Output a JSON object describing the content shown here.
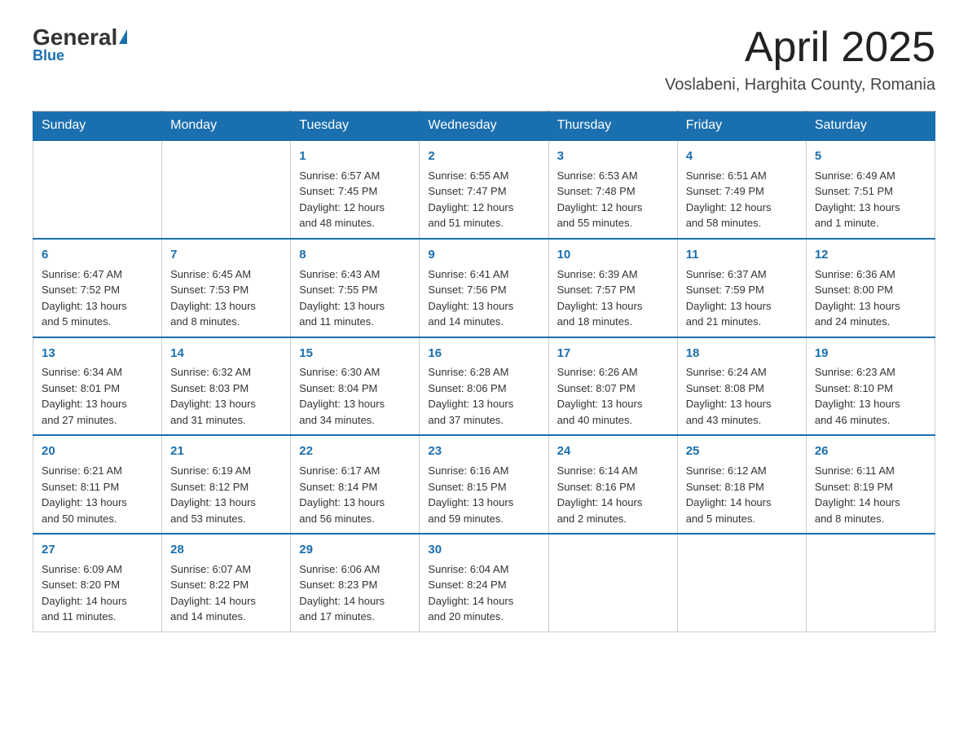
{
  "logo": {
    "general": "General",
    "blue": "Blue",
    "subtitle": "Blue"
  },
  "header": {
    "title": "April 2025",
    "location": "Voslabeni, Harghita County, Romania"
  },
  "days_of_week": [
    "Sunday",
    "Monday",
    "Tuesday",
    "Wednesday",
    "Thursday",
    "Friday",
    "Saturday"
  ],
  "weeks": [
    [
      {
        "day": "",
        "info": ""
      },
      {
        "day": "",
        "info": ""
      },
      {
        "day": "1",
        "info": "Sunrise: 6:57 AM\nSunset: 7:45 PM\nDaylight: 12 hours\nand 48 minutes."
      },
      {
        "day": "2",
        "info": "Sunrise: 6:55 AM\nSunset: 7:47 PM\nDaylight: 12 hours\nand 51 minutes."
      },
      {
        "day": "3",
        "info": "Sunrise: 6:53 AM\nSunset: 7:48 PM\nDaylight: 12 hours\nand 55 minutes."
      },
      {
        "day": "4",
        "info": "Sunrise: 6:51 AM\nSunset: 7:49 PM\nDaylight: 12 hours\nand 58 minutes."
      },
      {
        "day": "5",
        "info": "Sunrise: 6:49 AM\nSunset: 7:51 PM\nDaylight: 13 hours\nand 1 minute."
      }
    ],
    [
      {
        "day": "6",
        "info": "Sunrise: 6:47 AM\nSunset: 7:52 PM\nDaylight: 13 hours\nand 5 minutes."
      },
      {
        "day": "7",
        "info": "Sunrise: 6:45 AM\nSunset: 7:53 PM\nDaylight: 13 hours\nand 8 minutes."
      },
      {
        "day": "8",
        "info": "Sunrise: 6:43 AM\nSunset: 7:55 PM\nDaylight: 13 hours\nand 11 minutes."
      },
      {
        "day": "9",
        "info": "Sunrise: 6:41 AM\nSunset: 7:56 PM\nDaylight: 13 hours\nand 14 minutes."
      },
      {
        "day": "10",
        "info": "Sunrise: 6:39 AM\nSunset: 7:57 PM\nDaylight: 13 hours\nand 18 minutes."
      },
      {
        "day": "11",
        "info": "Sunrise: 6:37 AM\nSunset: 7:59 PM\nDaylight: 13 hours\nand 21 minutes."
      },
      {
        "day": "12",
        "info": "Sunrise: 6:36 AM\nSunset: 8:00 PM\nDaylight: 13 hours\nand 24 minutes."
      }
    ],
    [
      {
        "day": "13",
        "info": "Sunrise: 6:34 AM\nSunset: 8:01 PM\nDaylight: 13 hours\nand 27 minutes."
      },
      {
        "day": "14",
        "info": "Sunrise: 6:32 AM\nSunset: 8:03 PM\nDaylight: 13 hours\nand 31 minutes."
      },
      {
        "day": "15",
        "info": "Sunrise: 6:30 AM\nSunset: 8:04 PM\nDaylight: 13 hours\nand 34 minutes."
      },
      {
        "day": "16",
        "info": "Sunrise: 6:28 AM\nSunset: 8:06 PM\nDaylight: 13 hours\nand 37 minutes."
      },
      {
        "day": "17",
        "info": "Sunrise: 6:26 AM\nSunset: 8:07 PM\nDaylight: 13 hours\nand 40 minutes."
      },
      {
        "day": "18",
        "info": "Sunrise: 6:24 AM\nSunset: 8:08 PM\nDaylight: 13 hours\nand 43 minutes."
      },
      {
        "day": "19",
        "info": "Sunrise: 6:23 AM\nSunset: 8:10 PM\nDaylight: 13 hours\nand 46 minutes."
      }
    ],
    [
      {
        "day": "20",
        "info": "Sunrise: 6:21 AM\nSunset: 8:11 PM\nDaylight: 13 hours\nand 50 minutes."
      },
      {
        "day": "21",
        "info": "Sunrise: 6:19 AM\nSunset: 8:12 PM\nDaylight: 13 hours\nand 53 minutes."
      },
      {
        "day": "22",
        "info": "Sunrise: 6:17 AM\nSunset: 8:14 PM\nDaylight: 13 hours\nand 56 minutes."
      },
      {
        "day": "23",
        "info": "Sunrise: 6:16 AM\nSunset: 8:15 PM\nDaylight: 13 hours\nand 59 minutes."
      },
      {
        "day": "24",
        "info": "Sunrise: 6:14 AM\nSunset: 8:16 PM\nDaylight: 14 hours\nand 2 minutes."
      },
      {
        "day": "25",
        "info": "Sunrise: 6:12 AM\nSunset: 8:18 PM\nDaylight: 14 hours\nand 5 minutes."
      },
      {
        "day": "26",
        "info": "Sunrise: 6:11 AM\nSunset: 8:19 PM\nDaylight: 14 hours\nand 8 minutes."
      }
    ],
    [
      {
        "day": "27",
        "info": "Sunrise: 6:09 AM\nSunset: 8:20 PM\nDaylight: 14 hours\nand 11 minutes."
      },
      {
        "day": "28",
        "info": "Sunrise: 6:07 AM\nSunset: 8:22 PM\nDaylight: 14 hours\nand 14 minutes."
      },
      {
        "day": "29",
        "info": "Sunrise: 6:06 AM\nSunset: 8:23 PM\nDaylight: 14 hours\nand 17 minutes."
      },
      {
        "day": "30",
        "info": "Sunrise: 6:04 AM\nSunset: 8:24 PM\nDaylight: 14 hours\nand 20 minutes."
      },
      {
        "day": "",
        "info": ""
      },
      {
        "day": "",
        "info": ""
      },
      {
        "day": "",
        "info": ""
      }
    ]
  ]
}
